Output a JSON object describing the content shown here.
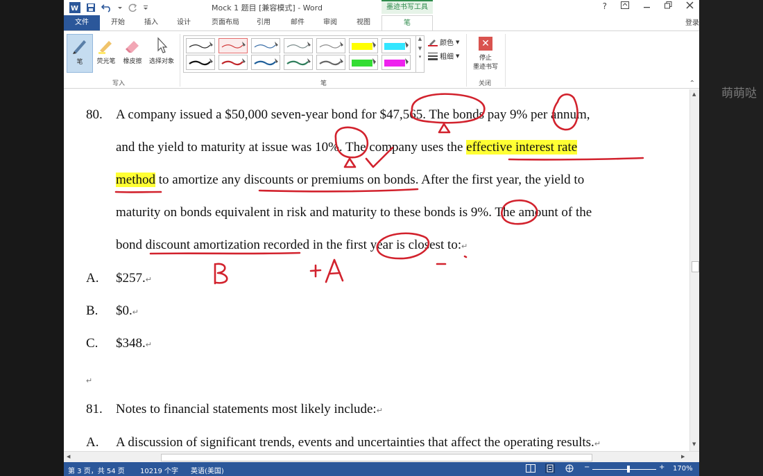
{
  "window": {
    "title": "Mock 1 题目 [兼容模式] - Word",
    "contextual_tab_group": "墨迹书写工具",
    "help": "?",
    "login": "登录"
  },
  "tabs": [
    {
      "label": "文件"
    },
    {
      "label": "开始"
    },
    {
      "label": "插入"
    },
    {
      "label": "设计"
    },
    {
      "label": "页面布局"
    },
    {
      "label": "引用"
    },
    {
      "label": "邮件"
    },
    {
      "label": "审阅"
    },
    {
      "label": "视图"
    },
    {
      "label": "笔"
    }
  ],
  "ribbon": {
    "write_group": {
      "label": "写入",
      "tools": [
        {
          "label": "笔",
          "icon": "pen-icon"
        },
        {
          "label": "荧光笔",
          "icon": "highlighter-icon"
        },
        {
          "label": "橡皮擦",
          "icon": "eraser-icon"
        },
        {
          "label": "选择对象",
          "icon": "select-pointer-icon"
        }
      ]
    },
    "pens_group": {
      "label": "笔",
      "pen_colors_row1": [
        "#222222",
        "#d23b3b",
        "#3b6fa8",
        "#7a8a8a",
        "#8a8a8a",
        "#ffff00",
        "#33e6ff"
      ],
      "pen_colors_row2": [
        "#111111",
        "#c0262b",
        "#1f5f9a",
        "#2e7d5b",
        "#666666",
        "#33dd33",
        "#ee22ee"
      ],
      "color_label": "颜色",
      "weight_label": "粗细"
    },
    "close_group": {
      "label": "关闭",
      "stop_label_1": "停止",
      "stop_label_2": "墨迹书写"
    }
  },
  "document": {
    "q80_num": "80.",
    "q80_l1a": "A company issued a $50,000 seven-year bond for ",
    "q80_l1b": "$47,565",
    "q80_l1c": ". The bonds pay ",
    "q80_l1d": "9%",
    "q80_l1e": " per annum,",
    "q80_l2a": "and the yield to maturity at issue was ",
    "q80_l2b": "10%",
    "q80_l2c": ". The company uses the ",
    "q80_l2d": "effective interest rate",
    "q80_l3a": "method",
    "q80_l3b": " to amortize any ",
    "q80_l3c": "discounts or premiums on",
    "q80_l3d": " bonds. After the first year, the yield to",
    "q80_l4a": "maturity on bonds equivalent in risk and maturity to these bonds is ",
    "q80_l4b": "9%",
    "q80_l4c": ". The amount of the",
    "q80_l5": "bond discount amortization recorded in the first year is closest to:",
    "options": [
      {
        "letter": "A.",
        "text": "$257."
      },
      {
        "letter": "B.",
        "text": "$0."
      },
      {
        "letter": "C.",
        "text": "$348."
      }
    ],
    "q81_num": "81.",
    "q81_text": "Notes to financial statements most likely include:",
    "q81_a_letter": "A.",
    "q81_a_text": "A discussion of significant trends, events and uncertainties that affect the operating results.",
    "para_mark": "↵",
    "ink_annotations": [
      "B",
      "+A",
      "-"
    ],
    "ink_color": "#d2222d"
  },
  "status": {
    "page": "第 3 页，共 54 页",
    "words": "10219 个字",
    "language": "英语(美国)",
    "zoom": "170%"
  },
  "watermark": "萌萌哒"
}
